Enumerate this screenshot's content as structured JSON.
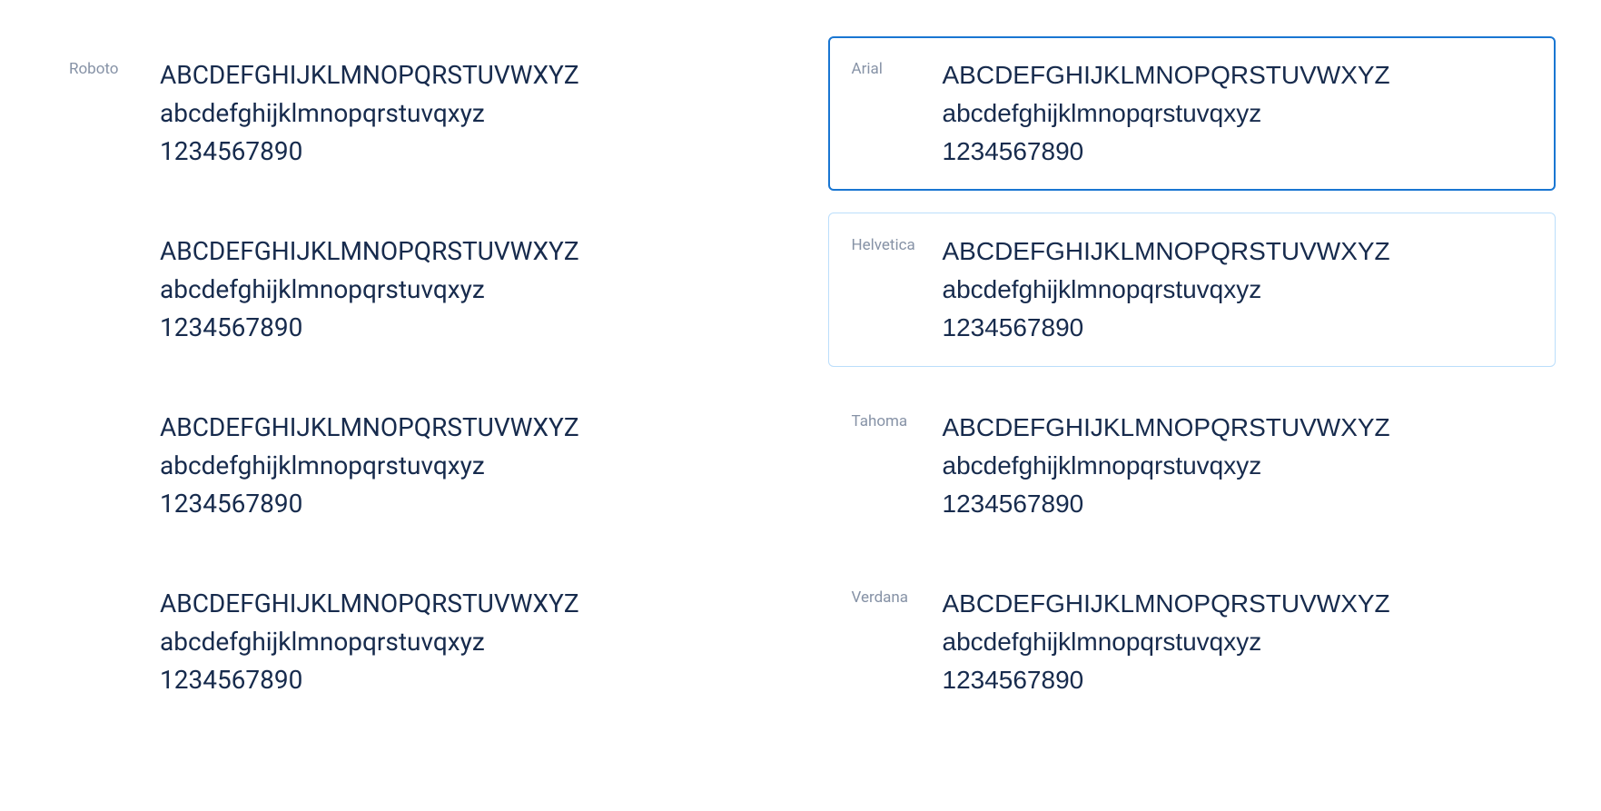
{
  "sample": {
    "upper": "ABCDEFGHIJKLMNOPQRSTUVWXYZ",
    "lower": "abcdefghijklmnopqrstuvqxyz",
    "digits": "1234567890"
  },
  "left_column": {
    "cards": [
      {
        "label": "Roboto",
        "font_class": "roboto",
        "state": "none"
      },
      {
        "label": "",
        "font_class": "roboto",
        "state": "none"
      },
      {
        "label": "",
        "font_class": "roboto",
        "state": "none"
      },
      {
        "label": "",
        "font_class": "roboto",
        "state": "none"
      }
    ]
  },
  "right_column": {
    "cards": [
      {
        "label": "Arial",
        "font_class": "arial",
        "state": "selected"
      },
      {
        "label": "Helvetica",
        "font_class": "helvetica",
        "state": "hovered"
      },
      {
        "label": "Tahoma",
        "font_class": "tahoma",
        "state": "none"
      },
      {
        "label": "Verdana",
        "font_class": "verdana",
        "state": "none"
      }
    ]
  },
  "colors": {
    "selected_border": "#1976d2",
    "hovered_border": "#bbdefb",
    "label_color": "#8692a6",
    "text_color": "#172b4d"
  }
}
